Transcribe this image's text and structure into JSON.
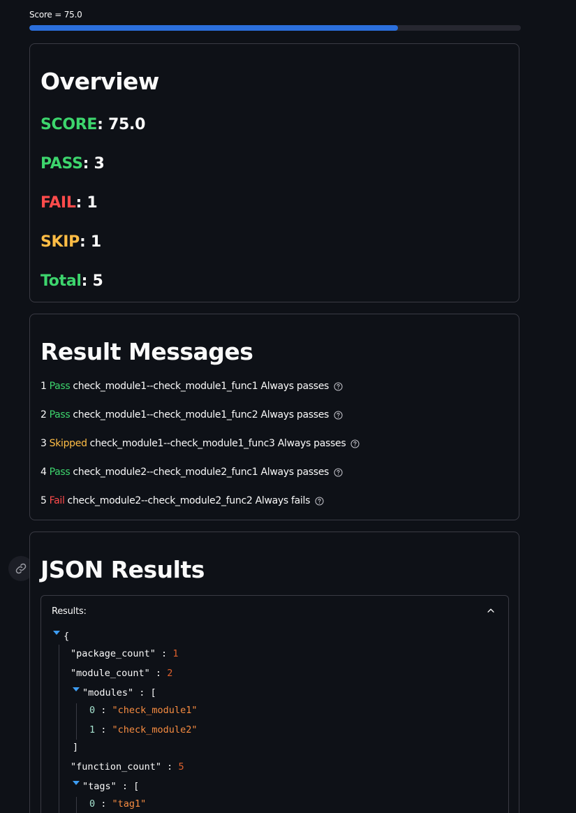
{
  "progress": {
    "label": "Score = 75.0",
    "fraction": 0.75,
    "color": "#2b6fdc"
  },
  "overview": {
    "title": "Overview",
    "stats": [
      {
        "key": "SCORE",
        "value": ": 75.0",
        "color": "#3dd56d"
      },
      {
        "key": "PASS",
        "value": ": 3",
        "color": "#3dd56d"
      },
      {
        "key": "FAIL",
        "value": ": 1",
        "color": "#ff4b4b"
      },
      {
        "key": "SKIP",
        "value": ": 1",
        "color": "#ffbd45"
      },
      {
        "key": "Total",
        "value": ": 5",
        "color": "#3dd56d"
      }
    ]
  },
  "messages": {
    "title": "Result Messages",
    "rows": [
      {
        "num": "1",
        "status": "Pass",
        "text": "check_module1--check_module1_func1 Always passes",
        "icon": "help-circle-icon"
      },
      {
        "num": "2",
        "status": "Pass",
        "text": "check_module1--check_module1_func2 Always passes",
        "icon": "help-circle-icon"
      },
      {
        "num": "3",
        "status": "Skipped",
        "text": "check_module1--check_module1_func3 Always passes",
        "icon": "help-circle-icon"
      },
      {
        "num": "4",
        "status": "Pass",
        "text": "check_module2--check_module2_func1 Always passes",
        "icon": "help-circle-icon"
      },
      {
        "num": "5",
        "status": "Fail",
        "text": "check_module2--check_module2_func2 Always fails",
        "icon": "help-circle-icon"
      }
    ]
  },
  "json_results": {
    "title": "JSON Results",
    "link_icon": "link-icon",
    "expander_label": "Results:",
    "chevron_icon": "chevron-up-icon",
    "lines": {
      "open_brace": "{",
      "package_count_key": "\"package_count\"",
      "package_count_value": "1",
      "module_count_key": "\"module_count\"",
      "module_count_value": "2",
      "modules_key": "\"modules\"",
      "open_bracket": "[",
      "modules_0_idx": "0",
      "modules_0_value": "\"check_module1\"",
      "modules_1_idx": "1",
      "modules_1_value": "\"check_module2\"",
      "close_bracket": "]",
      "function_count_key": "\"function_count\"",
      "function_count_value": "5",
      "tags_key": "\"tags\"",
      "tags_0_idx": "0",
      "tags_0_value": "\"tag1\"",
      "colon": " : "
    }
  },
  "colors": {
    "pass": "#3dd56d",
    "fail": "#ff4b4b",
    "skip": "#ffbd45",
    "background": "#0e1117"
  }
}
